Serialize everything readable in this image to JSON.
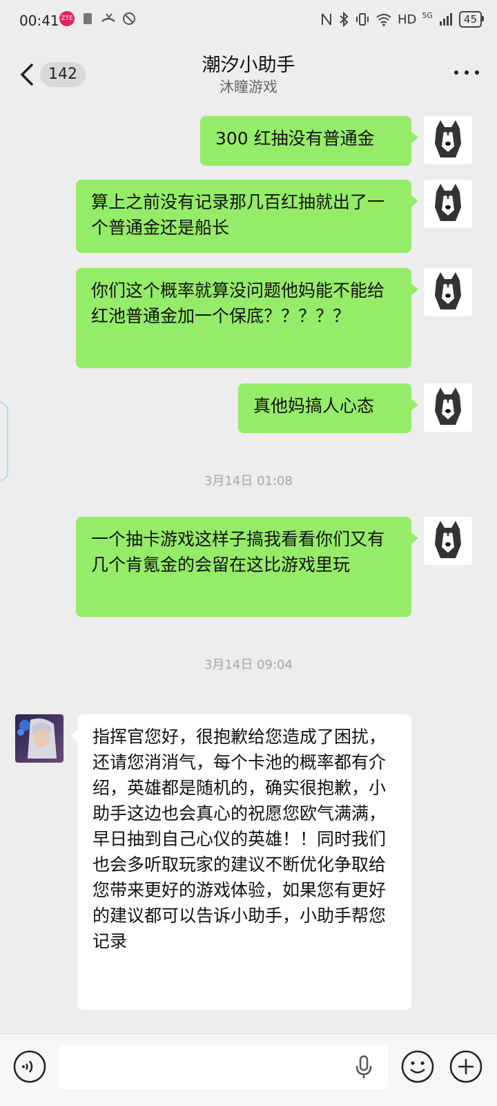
{
  "status": {
    "time": "00:41",
    "network": "HD",
    "gen": "5G",
    "battery": "45"
  },
  "header": {
    "unread_count": "142",
    "title": "潮汐小助手",
    "subtitle": "沐瞳游戏"
  },
  "messages": [
    {
      "text": "300 红抽没有普通金"
    },
    {
      "text": "算上之前没有记录那几百红抽就出了一个普通金还是船长"
    },
    {
      "text": "你们这个概率就算没问题他妈能不能给红池普通金加一个保底？？？？？"
    },
    {
      "text": "真他妈搞人心态"
    },
    {
      "text": "一个抽卡游戏这样子搞我看看你们又有几个肯氪金的会留在这比游戏里玩"
    },
    {
      "text": "指挥官您好，很抱歉给您造成了困扰，还请您消消气，每个卡池的概率都有介绍，英雄都是随机的，确实很抱歉，小助手这边也会真心的祝愿您欧气满满，早日抽到自己心仪的英雄！！同时我们也会多听取玩家的建议不断优化争取给您带来更好的游戏体验，如果您有更好的建议都可以告诉小助手，小助手帮您记录"
    }
  ],
  "timestamps": [
    "3月14日 01:08",
    "3月14日 09:04"
  ],
  "colors": {
    "my_bubble": "#95ec69",
    "their_bubble": "#ffffff",
    "background": "#ededed"
  },
  "icons": {
    "back": "chevron-left-icon",
    "more": "more-dots-icon",
    "voice": "voice-icon",
    "mic": "microphone-icon",
    "emoji": "emoji-icon",
    "plus": "plus-icon"
  }
}
